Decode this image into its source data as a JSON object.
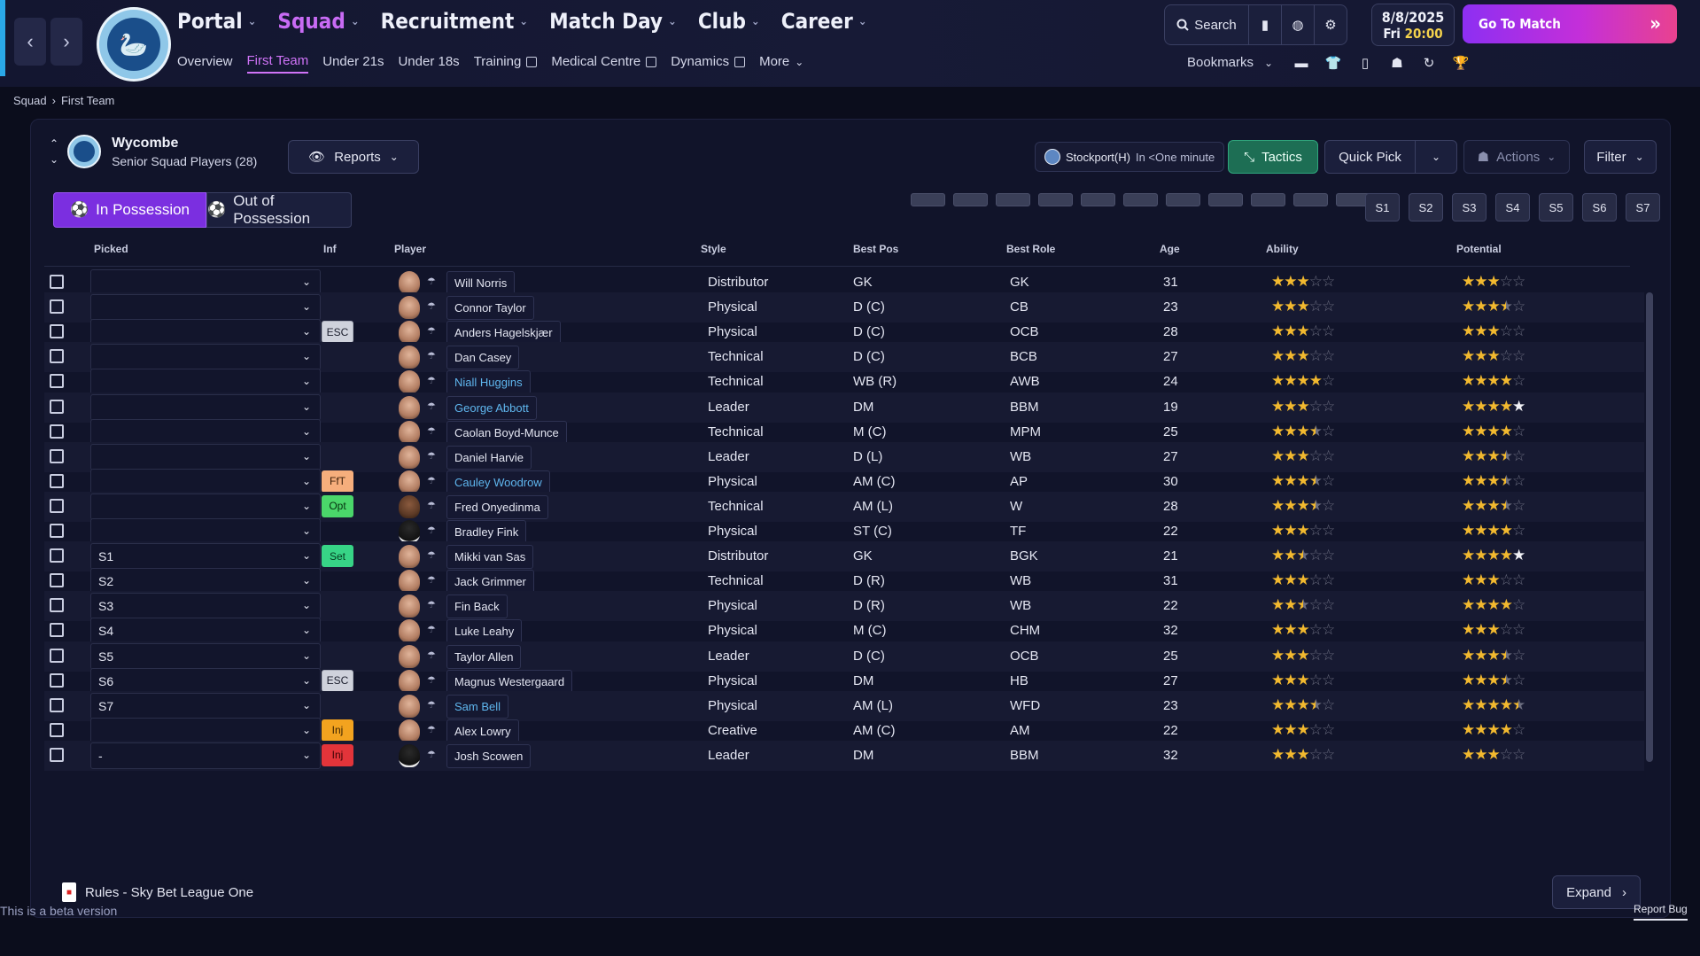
{
  "nav": {
    "main": [
      {
        "label": "Portal"
      },
      {
        "label": "Squad",
        "active": true
      },
      {
        "label": "Recruitment"
      },
      {
        "label": "Match Day"
      },
      {
        "label": "Club"
      },
      {
        "label": "Career"
      }
    ],
    "sub": [
      {
        "label": "Overview"
      },
      {
        "label": "First Team",
        "active": true
      },
      {
        "label": "Under 21s"
      },
      {
        "label": "Under 18s"
      },
      {
        "label": "Training",
        "external": true
      },
      {
        "label": "Medical Centre",
        "external": true
      },
      {
        "label": "Dynamics",
        "external": true
      },
      {
        "label": "More",
        "dropdown": true
      }
    ],
    "search_label": "Search",
    "date": "8/8/2025",
    "day": "Fri",
    "time": "20:00",
    "go_to_match": "Go To Match",
    "bookmarks": "Bookmarks"
  },
  "crest_text": "WYCOMBE WANDERERS",
  "breadcrumb": {
    "root": "Squad",
    "current": "First Team"
  },
  "team": {
    "name": "Wycombe",
    "subtitle": "Senior Squad Players (28)"
  },
  "toolbar": {
    "reports": "Reports",
    "next_match": "Stockport(H)",
    "next_match_time": "In <One minute",
    "tactics": "Tactics",
    "quick_pick": "Quick Pick",
    "actions": "Actions",
    "filter": "Filter"
  },
  "tabs": {
    "in_possession": "In Possession",
    "out_possession": "Out of Possession"
  },
  "sub_buttons": [
    "S1",
    "S2",
    "S3",
    "S4",
    "S5",
    "S6",
    "S7"
  ],
  "columns": {
    "picked": "Picked",
    "inf": "Inf",
    "player": "Player",
    "style": "Style",
    "best_pos": "Best Pos",
    "best_role": "Best Role",
    "age": "Age",
    "ability": "Ability",
    "potential": "Potential"
  },
  "players": [
    {
      "picked": "",
      "inf": "",
      "name": "Will Norris",
      "style": "Distributor",
      "pos": "GK",
      "role": "GK",
      "age": "31",
      "ability": 3,
      "potential": 3
    },
    {
      "picked": "",
      "inf": "",
      "name": "Connor Taylor",
      "style": "Physical",
      "pos": "D (C)",
      "role": "CB",
      "age": "23",
      "ability": 3,
      "potential": 3.5
    },
    {
      "picked": "",
      "inf": "ESC",
      "inf_type": "esc",
      "name": "Anders Hagelskjær",
      "style": "Physical",
      "pos": "D (C)",
      "role": "OCB",
      "age": "28",
      "ability": 3,
      "potential": 3
    },
    {
      "picked": "",
      "inf": "",
      "name": "Dan Casey",
      "style": "Technical",
      "pos": "D (C)",
      "role": "BCB",
      "age": "27",
      "ability": 3,
      "potential": 3
    },
    {
      "picked": "",
      "inf": "",
      "name": "Niall Huggins",
      "link": true,
      "style": "Technical",
      "pos": "WB (R)",
      "role": "AWB",
      "age": "24",
      "ability": 4,
      "potential": 4
    },
    {
      "picked": "",
      "inf": "",
      "name": "George Abbott",
      "link": true,
      "style": "Leader",
      "pos": "DM",
      "role": "BBM",
      "age": "19",
      "ability": 3,
      "potential": 4,
      "potential_white": 1
    },
    {
      "picked": "",
      "inf": "",
      "name": "Caolan Boyd-Munce",
      "style": "Technical",
      "pos": "M (C)",
      "role": "MPM",
      "age": "25",
      "ability": 3.5,
      "potential": 4
    },
    {
      "picked": "",
      "inf": "",
      "name": "Daniel Harvie",
      "style": "Leader",
      "pos": "D (L)",
      "role": "WB",
      "age": "27",
      "ability": 3,
      "potential": 3.5
    },
    {
      "picked": "",
      "inf": "FfT",
      "inf_type": "ftt",
      "name": "Cauley Woodrow",
      "link": true,
      "style": "Physical",
      "pos": "AM (C)",
      "role": "AP",
      "age": "30",
      "ability": 3.5,
      "potential": 3.5
    },
    {
      "picked": "",
      "inf": "Opt",
      "inf_type": "opt",
      "name": "Fred Onyedinma",
      "style": "Technical",
      "pos": "AM (L)",
      "role": "W",
      "age": "28",
      "ability": 3.5,
      "potential": 3.5,
      "face": "dark"
    },
    {
      "picked": "",
      "inf": "",
      "name": "Bradley Fink",
      "style": "Physical",
      "pos": "ST (C)",
      "role": "TF",
      "age": "22",
      "ability": 3,
      "potential": 4,
      "face": "sil"
    },
    {
      "picked": "S1",
      "inf": "Set",
      "inf_type": "set",
      "name": "Mikki van Sas",
      "style": "Distributor",
      "pos": "GK",
      "role": "BGK",
      "age": "21",
      "ability": 2.5,
      "potential": 4,
      "potential_white": 1
    },
    {
      "picked": "S2",
      "inf": "",
      "name": "Jack Grimmer",
      "style": "Technical",
      "pos": "D (R)",
      "role": "WB",
      "age": "31",
      "ability": 3,
      "potential": 3
    },
    {
      "picked": "S3",
      "inf": "",
      "name": "Fin Back",
      "style": "Physical",
      "pos": "D (R)",
      "role": "WB",
      "age": "22",
      "ability": 2.5,
      "potential": 4
    },
    {
      "picked": "S4",
      "inf": "",
      "name": "Luke Leahy",
      "style": "Physical",
      "pos": "M (C)",
      "role": "CHM",
      "age": "32",
      "ability": 3,
      "potential": 3
    },
    {
      "picked": "S5",
      "inf": "",
      "name": "Taylor Allen",
      "style": "Leader",
      "pos": "D (C)",
      "role": "OCB",
      "age": "25",
      "ability": 3,
      "potential": 3.5
    },
    {
      "picked": "S6",
      "inf": "ESC",
      "inf_type": "esc",
      "name": "Magnus Westergaard",
      "style": "Physical",
      "pos": "DM",
      "role": "HB",
      "age": "27",
      "ability": 3,
      "potential": 3.5
    },
    {
      "picked": "S7",
      "inf": "",
      "name": "Sam Bell",
      "link": true,
      "style": "Physical",
      "pos": "AM (L)",
      "role": "WFD",
      "age": "23",
      "ability": 3.5,
      "potential": 4.5
    },
    {
      "picked": "",
      "inf": "Inj",
      "inf_type": "injy",
      "name": "Alex Lowry",
      "style": "Creative",
      "pos": "AM (C)",
      "role": "AM",
      "age": "22",
      "ability": 3,
      "potential": 4
    },
    {
      "picked": "-",
      "inf": "Inj",
      "inf_type": "injr",
      "name": "Josh Scowen",
      "style": "Leader",
      "pos": "DM",
      "role": "BBM",
      "age": "32",
      "ability": 3,
      "potential": 3,
      "face": "sil"
    }
  ],
  "footer": {
    "rules": "Rules - Sky Bet League One",
    "expand": "Expand",
    "beta": "This is a beta version",
    "report_bug": "Report Bug"
  }
}
